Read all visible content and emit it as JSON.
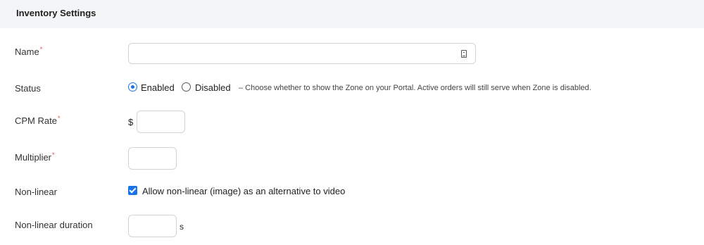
{
  "header": {
    "title": "Inventory Settings"
  },
  "form": {
    "name": {
      "label": "Name",
      "required_mark": "*",
      "value": "",
      "icon": "contact-card-icon"
    },
    "status": {
      "label": "Status",
      "options": [
        {
          "label": "Enabled",
          "selected": true
        },
        {
          "label": "Disabled",
          "selected": false
        }
      ],
      "hint": "– Choose whether to show the Zone on your Portal. Active orders will still serve when Zone is disabled."
    },
    "cpm_rate": {
      "label": "CPM Rate",
      "required_mark": "*",
      "prefix": "$",
      "value": ""
    },
    "multiplier": {
      "label": "Multiplier",
      "required_mark": "*",
      "value": ""
    },
    "non_linear": {
      "label": "Non-linear",
      "checkbox_label": "Allow non-linear (image) as an alternative to video",
      "checked": true
    },
    "non_linear_duration": {
      "label": "Non-linear duration",
      "suffix": "s",
      "value": ""
    }
  },
  "colors": {
    "accent": "#1a73e8",
    "required": "#e04b4b",
    "header_bg": "#f4f5f6"
  }
}
